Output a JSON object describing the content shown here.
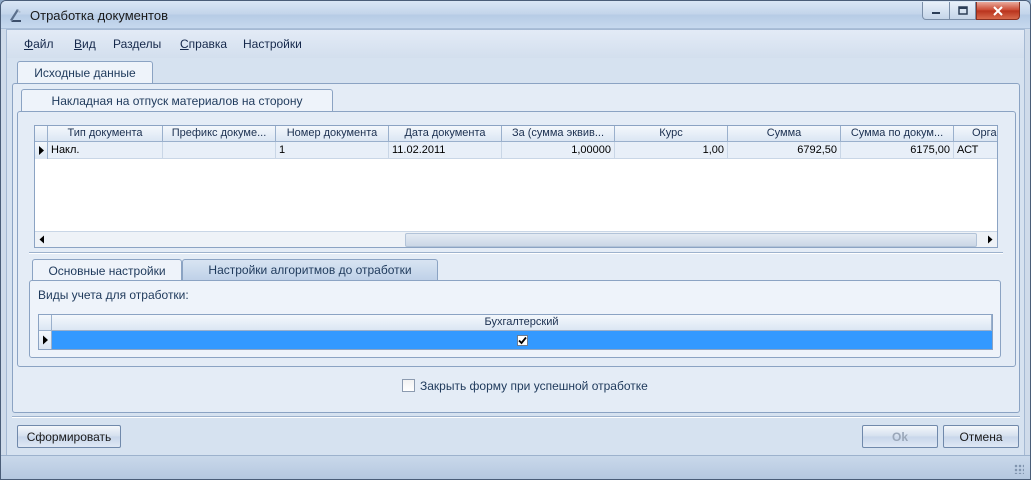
{
  "window": {
    "title": "Отработка документов"
  },
  "menu": [
    {
      "label": "Файл",
      "u": "Ф",
      "rest": "айл"
    },
    {
      "label": "Вид",
      "u": "В",
      "rest": "ид"
    },
    {
      "label": "Разделы",
      "u": "",
      "rest": "Разделы"
    },
    {
      "label": "Справка",
      "u": "С",
      "rest": "правка"
    },
    {
      "label": "Настройки",
      "u": "",
      "rest": "Настройки"
    }
  ],
  "tabs_top": {
    "source": "Исходные данные"
  },
  "tabs_doc": {
    "invoice": "Накладная на отпуск материалов на сторону"
  },
  "doc_grid": {
    "columns": [
      "Тип документа",
      "Префикс докуме...",
      "Номер документа",
      "Дата документа",
      "За (сумма эквив...",
      "Курс",
      "Сумма",
      "Сумма по докум...",
      "Орга"
    ],
    "rows": [
      [
        "Накл.",
        "",
        "1",
        "11.02.2011",
        "1,00000",
        "1,00",
        "6792,50",
        "6175,00",
        "АСТ"
      ]
    ]
  },
  "tabs_settings": {
    "basic": "Основные настройки",
    "algorithms": "Настройки алгоритмов до отработки"
  },
  "accounting": {
    "label": "Виды учета для отработки:",
    "columns": [
      "Бухгалтерский"
    ],
    "rows": [
      [
        true
      ]
    ]
  },
  "close_on_success": {
    "label": "Закрыть форму при успешной отработке",
    "checked": false
  },
  "buttons": {
    "generate": "Сформировать",
    "ok": "Ok",
    "cancel": "Отмена"
  },
  "icons": {
    "app": "document-process-icon",
    "checkmark": "checkmark-icon"
  },
  "colors": {
    "selection": "#3399ff",
    "accent": "#1e395b"
  }
}
